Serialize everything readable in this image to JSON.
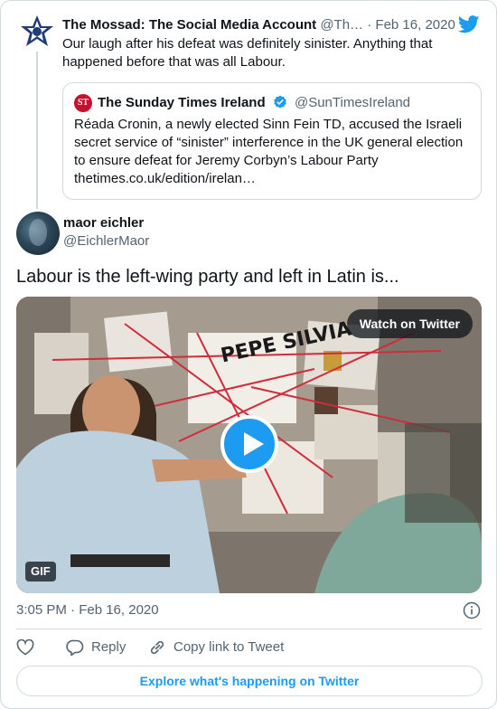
{
  "parent_tweet": {
    "name": "The Mossad: The Social Media Account",
    "handle": "@Th…",
    "separator": "·",
    "date": "Feb 16, 2020",
    "text": "Our laugh after his defeat was definitely sinister. Anything that happened before that was all Labour."
  },
  "quoted_tweet": {
    "logo_text": "ST",
    "name": "The Sunday Times Ireland",
    "handle": "@SunTimesIreland",
    "text": "Réada Cronin, a newly elected Sinn Fein TD, accused the Israeli secret service of “sinister” interference in the UK general election to ensure defeat for Jeremy Corbyn’s Labour Party thetimes.co.uk/edition/irelan…"
  },
  "main_tweet": {
    "name": "maor eichler",
    "handle": "@EichlerMaor",
    "text": "Labour is the left-wing party and left in Latin is...",
    "media": {
      "watch_label": "Watch on Twitter",
      "gif_label": "GIF",
      "board_text": "PEPE SILVIA"
    },
    "time": "3:05 PM · Feb 16, 2020"
  },
  "actions": {
    "reply": "Reply",
    "copy_link": "Copy link to Tweet"
  },
  "explore_label": "Explore what's happening on Twitter",
  "colors": {
    "accent": "#1d9bf0",
    "text": "#0f1419",
    "secondary": "#536471",
    "border": "#cfd9de"
  }
}
